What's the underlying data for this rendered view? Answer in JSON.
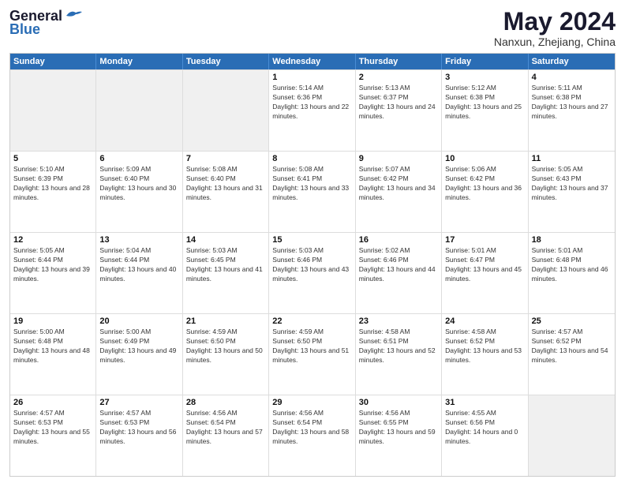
{
  "header": {
    "logo": {
      "line1": "General",
      "line2": "Blue"
    },
    "title": "May 2024",
    "location": "Nanxun, Zhejiang, China"
  },
  "days_of_week": [
    "Sunday",
    "Monday",
    "Tuesday",
    "Wednesday",
    "Thursday",
    "Friday",
    "Saturday"
  ],
  "weeks": [
    {
      "cells": [
        {
          "day": "",
          "empty": true
        },
        {
          "day": "",
          "empty": true
        },
        {
          "day": "",
          "empty": true
        },
        {
          "day": "1",
          "sunrise": "Sunrise: 5:14 AM",
          "sunset": "Sunset: 6:36 PM",
          "daylight": "Daylight: 13 hours and 22 minutes."
        },
        {
          "day": "2",
          "sunrise": "Sunrise: 5:13 AM",
          "sunset": "Sunset: 6:37 PM",
          "daylight": "Daylight: 13 hours and 24 minutes."
        },
        {
          "day": "3",
          "sunrise": "Sunrise: 5:12 AM",
          "sunset": "Sunset: 6:38 PM",
          "daylight": "Daylight: 13 hours and 25 minutes."
        },
        {
          "day": "4",
          "sunrise": "Sunrise: 5:11 AM",
          "sunset": "Sunset: 6:38 PM",
          "daylight": "Daylight: 13 hours and 27 minutes."
        }
      ]
    },
    {
      "cells": [
        {
          "day": "5",
          "sunrise": "Sunrise: 5:10 AM",
          "sunset": "Sunset: 6:39 PM",
          "daylight": "Daylight: 13 hours and 28 minutes."
        },
        {
          "day": "6",
          "sunrise": "Sunrise: 5:09 AM",
          "sunset": "Sunset: 6:40 PM",
          "daylight": "Daylight: 13 hours and 30 minutes."
        },
        {
          "day": "7",
          "sunrise": "Sunrise: 5:08 AM",
          "sunset": "Sunset: 6:40 PM",
          "daylight": "Daylight: 13 hours and 31 minutes."
        },
        {
          "day": "8",
          "sunrise": "Sunrise: 5:08 AM",
          "sunset": "Sunset: 6:41 PM",
          "daylight": "Daylight: 13 hours and 33 minutes."
        },
        {
          "day": "9",
          "sunrise": "Sunrise: 5:07 AM",
          "sunset": "Sunset: 6:42 PM",
          "daylight": "Daylight: 13 hours and 34 minutes."
        },
        {
          "day": "10",
          "sunrise": "Sunrise: 5:06 AM",
          "sunset": "Sunset: 6:42 PM",
          "daylight": "Daylight: 13 hours and 36 minutes."
        },
        {
          "day": "11",
          "sunrise": "Sunrise: 5:05 AM",
          "sunset": "Sunset: 6:43 PM",
          "daylight": "Daylight: 13 hours and 37 minutes."
        }
      ]
    },
    {
      "cells": [
        {
          "day": "12",
          "sunrise": "Sunrise: 5:05 AM",
          "sunset": "Sunset: 6:44 PM",
          "daylight": "Daylight: 13 hours and 39 minutes."
        },
        {
          "day": "13",
          "sunrise": "Sunrise: 5:04 AM",
          "sunset": "Sunset: 6:44 PM",
          "daylight": "Daylight: 13 hours and 40 minutes."
        },
        {
          "day": "14",
          "sunrise": "Sunrise: 5:03 AM",
          "sunset": "Sunset: 6:45 PM",
          "daylight": "Daylight: 13 hours and 41 minutes."
        },
        {
          "day": "15",
          "sunrise": "Sunrise: 5:03 AM",
          "sunset": "Sunset: 6:46 PM",
          "daylight": "Daylight: 13 hours and 43 minutes."
        },
        {
          "day": "16",
          "sunrise": "Sunrise: 5:02 AM",
          "sunset": "Sunset: 6:46 PM",
          "daylight": "Daylight: 13 hours and 44 minutes."
        },
        {
          "day": "17",
          "sunrise": "Sunrise: 5:01 AM",
          "sunset": "Sunset: 6:47 PM",
          "daylight": "Daylight: 13 hours and 45 minutes."
        },
        {
          "day": "18",
          "sunrise": "Sunrise: 5:01 AM",
          "sunset": "Sunset: 6:48 PM",
          "daylight": "Daylight: 13 hours and 46 minutes."
        }
      ]
    },
    {
      "cells": [
        {
          "day": "19",
          "sunrise": "Sunrise: 5:00 AM",
          "sunset": "Sunset: 6:48 PM",
          "daylight": "Daylight: 13 hours and 48 minutes."
        },
        {
          "day": "20",
          "sunrise": "Sunrise: 5:00 AM",
          "sunset": "Sunset: 6:49 PM",
          "daylight": "Daylight: 13 hours and 49 minutes."
        },
        {
          "day": "21",
          "sunrise": "Sunrise: 4:59 AM",
          "sunset": "Sunset: 6:50 PM",
          "daylight": "Daylight: 13 hours and 50 minutes."
        },
        {
          "day": "22",
          "sunrise": "Sunrise: 4:59 AM",
          "sunset": "Sunset: 6:50 PM",
          "daylight": "Daylight: 13 hours and 51 minutes."
        },
        {
          "day": "23",
          "sunrise": "Sunrise: 4:58 AM",
          "sunset": "Sunset: 6:51 PM",
          "daylight": "Daylight: 13 hours and 52 minutes."
        },
        {
          "day": "24",
          "sunrise": "Sunrise: 4:58 AM",
          "sunset": "Sunset: 6:52 PM",
          "daylight": "Daylight: 13 hours and 53 minutes."
        },
        {
          "day": "25",
          "sunrise": "Sunrise: 4:57 AM",
          "sunset": "Sunset: 6:52 PM",
          "daylight": "Daylight: 13 hours and 54 minutes."
        }
      ]
    },
    {
      "cells": [
        {
          "day": "26",
          "sunrise": "Sunrise: 4:57 AM",
          "sunset": "Sunset: 6:53 PM",
          "daylight": "Daylight: 13 hours and 55 minutes."
        },
        {
          "day": "27",
          "sunrise": "Sunrise: 4:57 AM",
          "sunset": "Sunset: 6:53 PM",
          "daylight": "Daylight: 13 hours and 56 minutes."
        },
        {
          "day": "28",
          "sunrise": "Sunrise: 4:56 AM",
          "sunset": "Sunset: 6:54 PM",
          "daylight": "Daylight: 13 hours and 57 minutes."
        },
        {
          "day": "29",
          "sunrise": "Sunrise: 4:56 AM",
          "sunset": "Sunset: 6:54 PM",
          "daylight": "Daylight: 13 hours and 58 minutes."
        },
        {
          "day": "30",
          "sunrise": "Sunrise: 4:56 AM",
          "sunset": "Sunset: 6:55 PM",
          "daylight": "Daylight: 13 hours and 59 minutes."
        },
        {
          "day": "31",
          "sunrise": "Sunrise: 4:55 AM",
          "sunset": "Sunset: 6:56 PM",
          "daylight": "Daylight: 14 hours and 0 minutes."
        },
        {
          "day": "",
          "empty": true
        }
      ]
    }
  ]
}
